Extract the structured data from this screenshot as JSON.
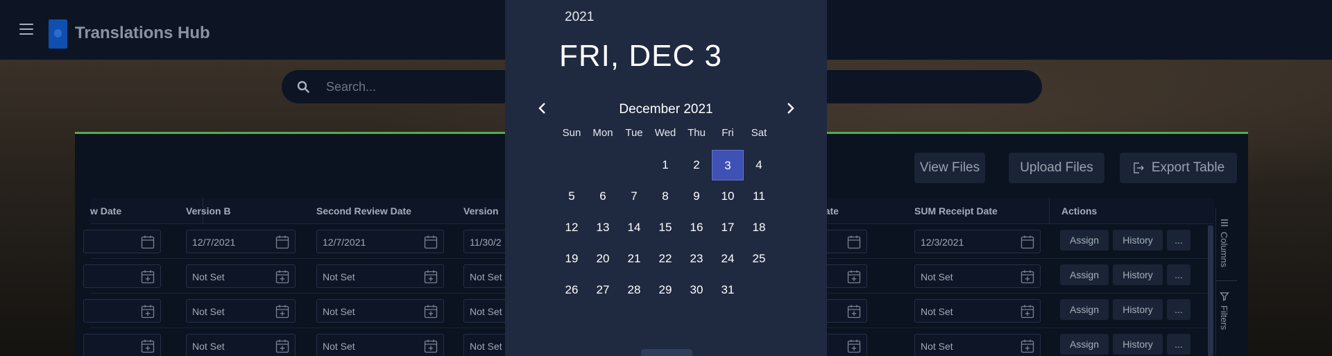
{
  "header": {
    "title": "Translations Hub"
  },
  "search": {
    "placeholder": "Search..."
  },
  "toolbar": {
    "view_files": "View Files",
    "upload_files": "Upload Files",
    "export_table": "Export Table"
  },
  "grid": {
    "columns": [
      "w Date",
      "Version B",
      "Second Review Date",
      "Version",
      "t Date",
      "SUM Receipt Date",
      "Actions"
    ],
    "rows": [
      {
        "c1": "",
        "c2": "12/7/2021",
        "c3": "12/7/2021",
        "c4": "11/30/2",
        "c5": "",
        "c6": "12/3/2021"
      },
      {
        "c1": "",
        "c2": "Not Set",
        "c3": "Not Set",
        "c4": "Not Set",
        "c5": "",
        "c6": "Not Set"
      },
      {
        "c1": "",
        "c2": "Not Set",
        "c3": "Not Set",
        "c4": "Not Set",
        "c5": "",
        "c6": "Not Set"
      },
      {
        "c1": "",
        "c2": "Not Set",
        "c3": "Not Set",
        "c4": "Not Set",
        "c5": "",
        "c6": "Not Set"
      }
    ],
    "actions": {
      "assign": "Assign",
      "history": "History",
      "more": "..."
    }
  },
  "side_tools": {
    "columns": "Columns",
    "filters": "Filters"
  },
  "datepicker": {
    "year": "2021",
    "selected_label": "FRI, DEC 3",
    "month_label": "December 2021",
    "weekdays": [
      "Sun",
      "Mon",
      "Tue",
      "Wed",
      "Thu",
      "Fri",
      "Sat"
    ],
    "first_weekday_index": 3,
    "days_in_month": 31,
    "selected_day": 3,
    "accent_color": "#3f51b5"
  }
}
